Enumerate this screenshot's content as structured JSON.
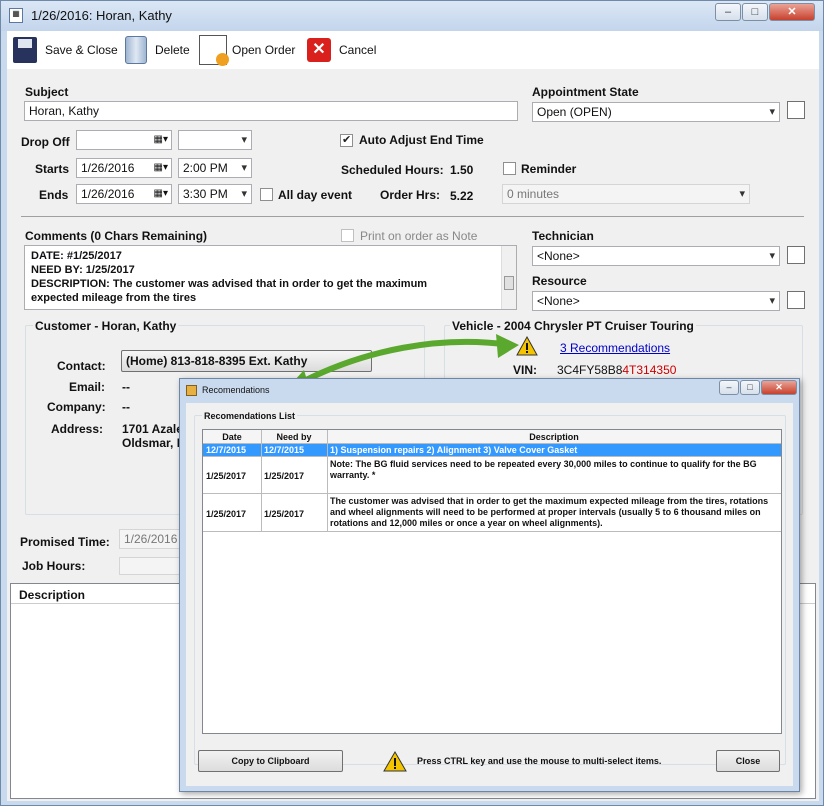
{
  "window": {
    "title": "1/26/2016: Horan, Kathy"
  },
  "toolbar": {
    "save_close": "Save & Close",
    "delete": "Delete",
    "open_order": "Open Order",
    "cancel": "Cancel"
  },
  "form": {
    "subject_label": "Subject",
    "subject_value": "Horan, Kathy",
    "appt_state_label": "Appointment State",
    "appt_state_value": "Open (OPEN)",
    "drop_off_label": "Drop Off",
    "starts_label": "Starts",
    "starts_date": "1/26/2016",
    "starts_time": "2:00 PM",
    "ends_label": "Ends",
    "ends_date": "1/26/2016",
    "ends_time": "3:30 PM",
    "all_day_label": "All day event",
    "auto_adjust_label": "Auto Adjust End Time",
    "sched_hours_label": "Scheduled Hours:",
    "sched_hours_value": "1.50",
    "order_hrs_label": "Order Hrs:",
    "order_hrs_value": "5.22",
    "reminder_label": "Reminder",
    "reminder_value": "0 minutes",
    "comments_label": "Comments (0 Chars Remaining)",
    "print_note_label": "Print on order as Note",
    "comments_lines": [
      "DATE: #1/25/2017",
      "NEED BY: 1/25/2017",
      "DESCRIPTION: The customer was advised that in order to get the maximum",
      "expected mileage from the tires"
    ],
    "technician_label": "Technician",
    "technician_value": "<None>",
    "resource_label": "Resource",
    "resource_value": "<None>",
    "customer_title": "Customer - Horan, Kathy",
    "contact_label": "Contact:",
    "contact_value": "(Home)  813-818-8395  Ext. Kathy",
    "email_label": "Email:",
    "email_value": "--",
    "company_label": "Company:",
    "company_value": "--",
    "address_label": "Address:",
    "address_line1": "1701 Azale",
    "address_line2": "Oldsmar, F",
    "vehicle_title": "Vehicle - 2004 Chrysler PT Cruiser Touring",
    "recommendations_link": "3 Recommendations",
    "vin_label": "VIN:",
    "vin_part1": "3C4FY58B8",
    "vin_part2": "4T314350",
    "promised_label": "Promised Time:",
    "promised_value": "1/26/2016",
    "job_hours_label": "Job Hours:",
    "description_header": "Description"
  },
  "dialog": {
    "title": "Recomendations",
    "list_label": "Recomendations List",
    "columns": [
      "Date",
      "Need by",
      "Description"
    ],
    "rows": [
      {
        "date": "12/7/2015",
        "need_by": "12/7/2015",
        "description": "1) Suspension repairs 2) Alignment 3) Valve Cover Gasket"
      },
      {
        "date": "1/25/2017",
        "need_by": "1/25/2017",
        "description": "Note: The BG fluid services need to be repeated every 30,000 miles to continue to qualify for the BG warranty. *"
      },
      {
        "date": "1/25/2017",
        "need_by": "1/25/2017",
        "description": "The customer was advised that in order to get the maximum expected mileage from the tires, rotations and wheel alignments will need to be performed at proper intervals (usually 5 to 6 thousand miles on rotations and 12,000 miles or once a year on wheel alignments)."
      }
    ],
    "copy_button": "Copy to Clipboard",
    "hint": "Press CTRL key and use the mouse to multi-select items.",
    "close_button": "Close"
  },
  "colors": {
    "selected_row": "#3399ff",
    "vin_red": "#cc0000",
    "link": "#0000cc",
    "arrow": "#5aa82e"
  }
}
